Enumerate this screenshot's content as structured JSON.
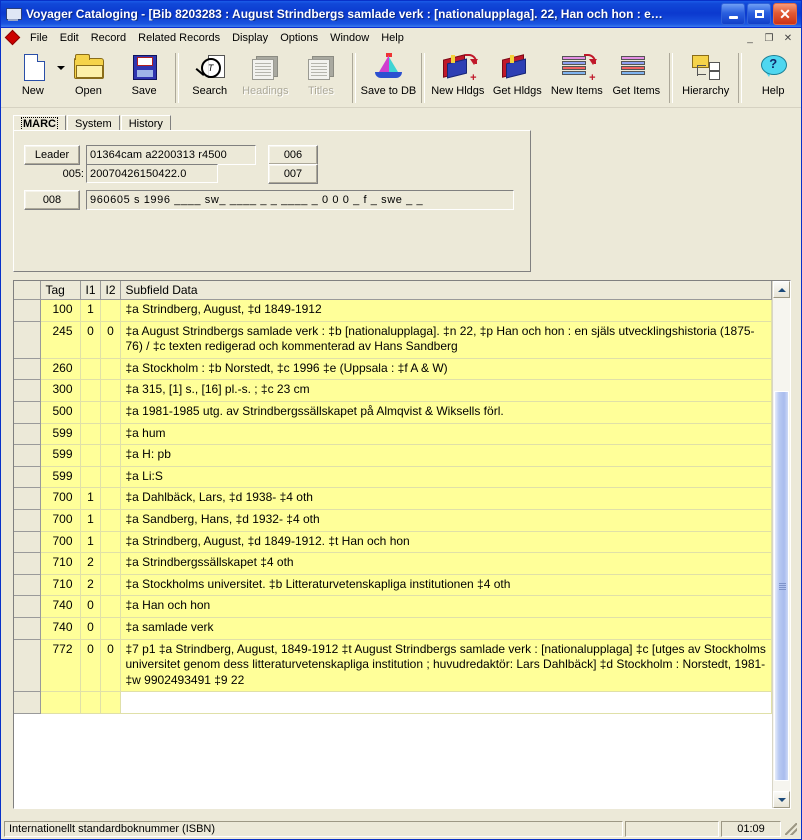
{
  "window": {
    "title": "Voyager Cataloging - [Bib 8203283 : August Strindbergs samlade verk : [nationalupplaga]. 22, Han och hon : e…",
    "icon": "app-window-icon",
    "minimize_label": "",
    "maximize_label": "",
    "close_label": "✕",
    "mdi_minimize": "_",
    "mdi_restore": "❐",
    "mdi_close": "✕"
  },
  "menu": {
    "items": [
      {
        "label": "File"
      },
      {
        "label": "Edit"
      },
      {
        "label": "Record"
      },
      {
        "label": "Related Records"
      },
      {
        "label": "Display"
      },
      {
        "label": "Options"
      },
      {
        "label": "Window"
      },
      {
        "label": "Help"
      }
    ]
  },
  "toolbar": {
    "buttons": [
      {
        "label": "New",
        "icon": "new-document-icon",
        "enabled": true,
        "has_dropdown": true
      },
      {
        "label": "Open",
        "icon": "open-folder-icon",
        "enabled": true,
        "has_dropdown": false
      },
      {
        "label": "Save",
        "icon": "floppy-disk-icon",
        "enabled": true,
        "has_dropdown": false
      },
      {
        "label": "Search",
        "icon": "magnifier-icon",
        "enabled": true,
        "has_dropdown": false
      },
      {
        "label": "Headings",
        "icon": "pages-icon",
        "enabled": false,
        "has_dropdown": false
      },
      {
        "label": "Titles",
        "icon": "titles-icon",
        "enabled": false,
        "has_dropdown": false
      },
      {
        "label": "Save to DB",
        "icon": "sailboat-icon",
        "enabled": true,
        "has_dropdown": false
      },
      {
        "label": "New Hldgs",
        "icon": "book-plus-icon",
        "enabled": true,
        "has_dropdown": false
      },
      {
        "label": "Get Hldgs",
        "icon": "book-icon",
        "enabled": true,
        "has_dropdown": false
      },
      {
        "label": "New Items",
        "icon": "books-plus-icon",
        "enabled": true,
        "has_dropdown": false
      },
      {
        "label": "Get Items",
        "icon": "books-icon",
        "enabled": true,
        "has_dropdown": false
      },
      {
        "label": "Hierarchy",
        "icon": "hierarchy-icon",
        "enabled": true,
        "has_dropdown": false
      },
      {
        "label": "Help",
        "icon": "help-balloon-icon",
        "enabled": true,
        "has_dropdown": false
      }
    ]
  },
  "tabs": [
    {
      "label": "MARC",
      "active": true
    },
    {
      "label": "System",
      "active": false
    },
    {
      "label": "History",
      "active": false
    }
  ],
  "fixed_fields": {
    "leader_button": "Leader",
    "leader_value": "01364cam a2200313  r4500",
    "field_005_label": "005:",
    "field_005_value": "20070426150422.0",
    "field_006_button": "006",
    "field_007_button": "007",
    "field_008_button": "008",
    "field_008_value": "960605 s 1996 ____  sw_  ____  _ _  ____  _  0 0 0 _  f _  swe _ _"
  },
  "grid": {
    "columns": [
      "",
      "Tag",
      "I1",
      "I2",
      "Subfield Data"
    ],
    "rows": [
      {
        "tag": "100",
        "i1": "1",
        "i2": "",
        "data": "‡a Strindberg, August, ‡d 1849-1912"
      },
      {
        "tag": "245",
        "i1": "0",
        "i2": "0",
        "data": "‡a August Strindbergs samlade verk : ‡b [nationalupplaga]. ‡n 22, ‡p Han och hon : en själs utvecklingshistoria (1875-76) / ‡c texten redigerad och kommenterad av Hans Sandberg"
      },
      {
        "tag": "260",
        "i1": "",
        "i2": "",
        "data": "‡a Stockholm : ‡b Norstedt, ‡c 1996 ‡e (Uppsala : ‡f A & W)"
      },
      {
        "tag": "300",
        "i1": "",
        "i2": "",
        "data": "‡a 315, [1] s., [16] pl.-s. ; ‡c 23 cm"
      },
      {
        "tag": "500",
        "i1": "",
        "i2": "",
        "data": "‡a 1981-1985 utg. av Strindbergssällskapet på Almqvist & Wiksells förl."
      },
      {
        "tag": "599",
        "i1": "",
        "i2": "",
        "data": "‡a hum"
      },
      {
        "tag": "599",
        "i1": "",
        "i2": "",
        "data": "‡a H: pb"
      },
      {
        "tag": "599",
        "i1": "",
        "i2": "",
        "data": "‡a Li:S"
      },
      {
        "tag": "700",
        "i1": "1",
        "i2": "",
        "data": "‡a Dahlbäck, Lars, ‡d 1938- ‡4 oth"
      },
      {
        "tag": "700",
        "i1": "1",
        "i2": "",
        "data": "‡a Sandberg, Hans, ‡d 1932- ‡4 oth"
      },
      {
        "tag": "700",
        "i1": "1",
        "i2": "",
        "data": "‡a Strindberg, August, ‡d 1849-1912. ‡t Han och hon"
      },
      {
        "tag": "710",
        "i1": "2",
        "i2": "",
        "data": "‡a Strindbergssällskapet ‡4 oth"
      },
      {
        "tag": "710",
        "i1": "2",
        "i2": "",
        "data": "‡a Stockholms universitet. ‡b Litteraturvetenskapliga institutionen ‡4 oth"
      },
      {
        "tag": "740",
        "i1": "0",
        "i2": "",
        "data": "‡a Han och hon"
      },
      {
        "tag": "740",
        "i1": "0",
        "i2": "",
        "data": "‡a samlade verk"
      },
      {
        "tag": "772",
        "i1": "0",
        "i2": "0",
        "data": "‡7 p1 ‡a Strindberg, August, 1849-1912 ‡t August Strindbergs samlade verk : [nationalupplaga] ‡c [utges av Stockholms universitet genom dess litteraturvetenskapliga institution ; huvudredaktör: Lars Dahlbäck] ‡d Stockholm : Norstedt, 1981- ‡w 9902493491 ‡9 22"
      }
    ]
  },
  "statusbar": {
    "message": "Internationellt standardboknummer (ISBN)",
    "middle": "",
    "time": "01:09"
  },
  "colors": {
    "title_blue": "#0b39cf",
    "face": "#ece9d8",
    "row_yellow": "#ffff99",
    "grid_line": "#e0e0a8"
  }
}
